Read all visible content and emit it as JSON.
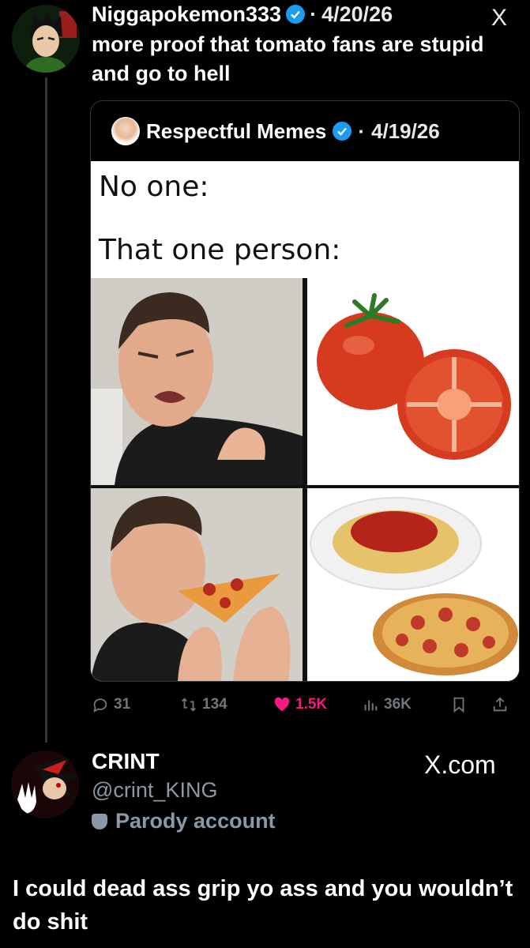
{
  "tweet": {
    "author": "Niggapokemon333",
    "separator": "·",
    "date": "4/20/26",
    "text": "more proof that tomato fans are stupid and go to hell",
    "platform_icon": "X"
  },
  "quoted_tweet": {
    "author": "Respectful Memes",
    "separator": "·",
    "date": "4/19/26",
    "meme": {
      "line1": "No one:",
      "line2": "That one person:"
    }
  },
  "actions": {
    "replies": "31",
    "reposts": "134",
    "likes": "1.5K",
    "views": "36K"
  },
  "profile": {
    "name": "CRINT",
    "handle": "@crint_KING",
    "label": "Parody account",
    "site": "X.com"
  },
  "post_text": "I could dead ass grip yo ass and you wouldn’t do shit",
  "colors": {
    "background": "#000000",
    "verified": "#1d9bf0",
    "like": "#f91880",
    "muted": "#71767b"
  }
}
